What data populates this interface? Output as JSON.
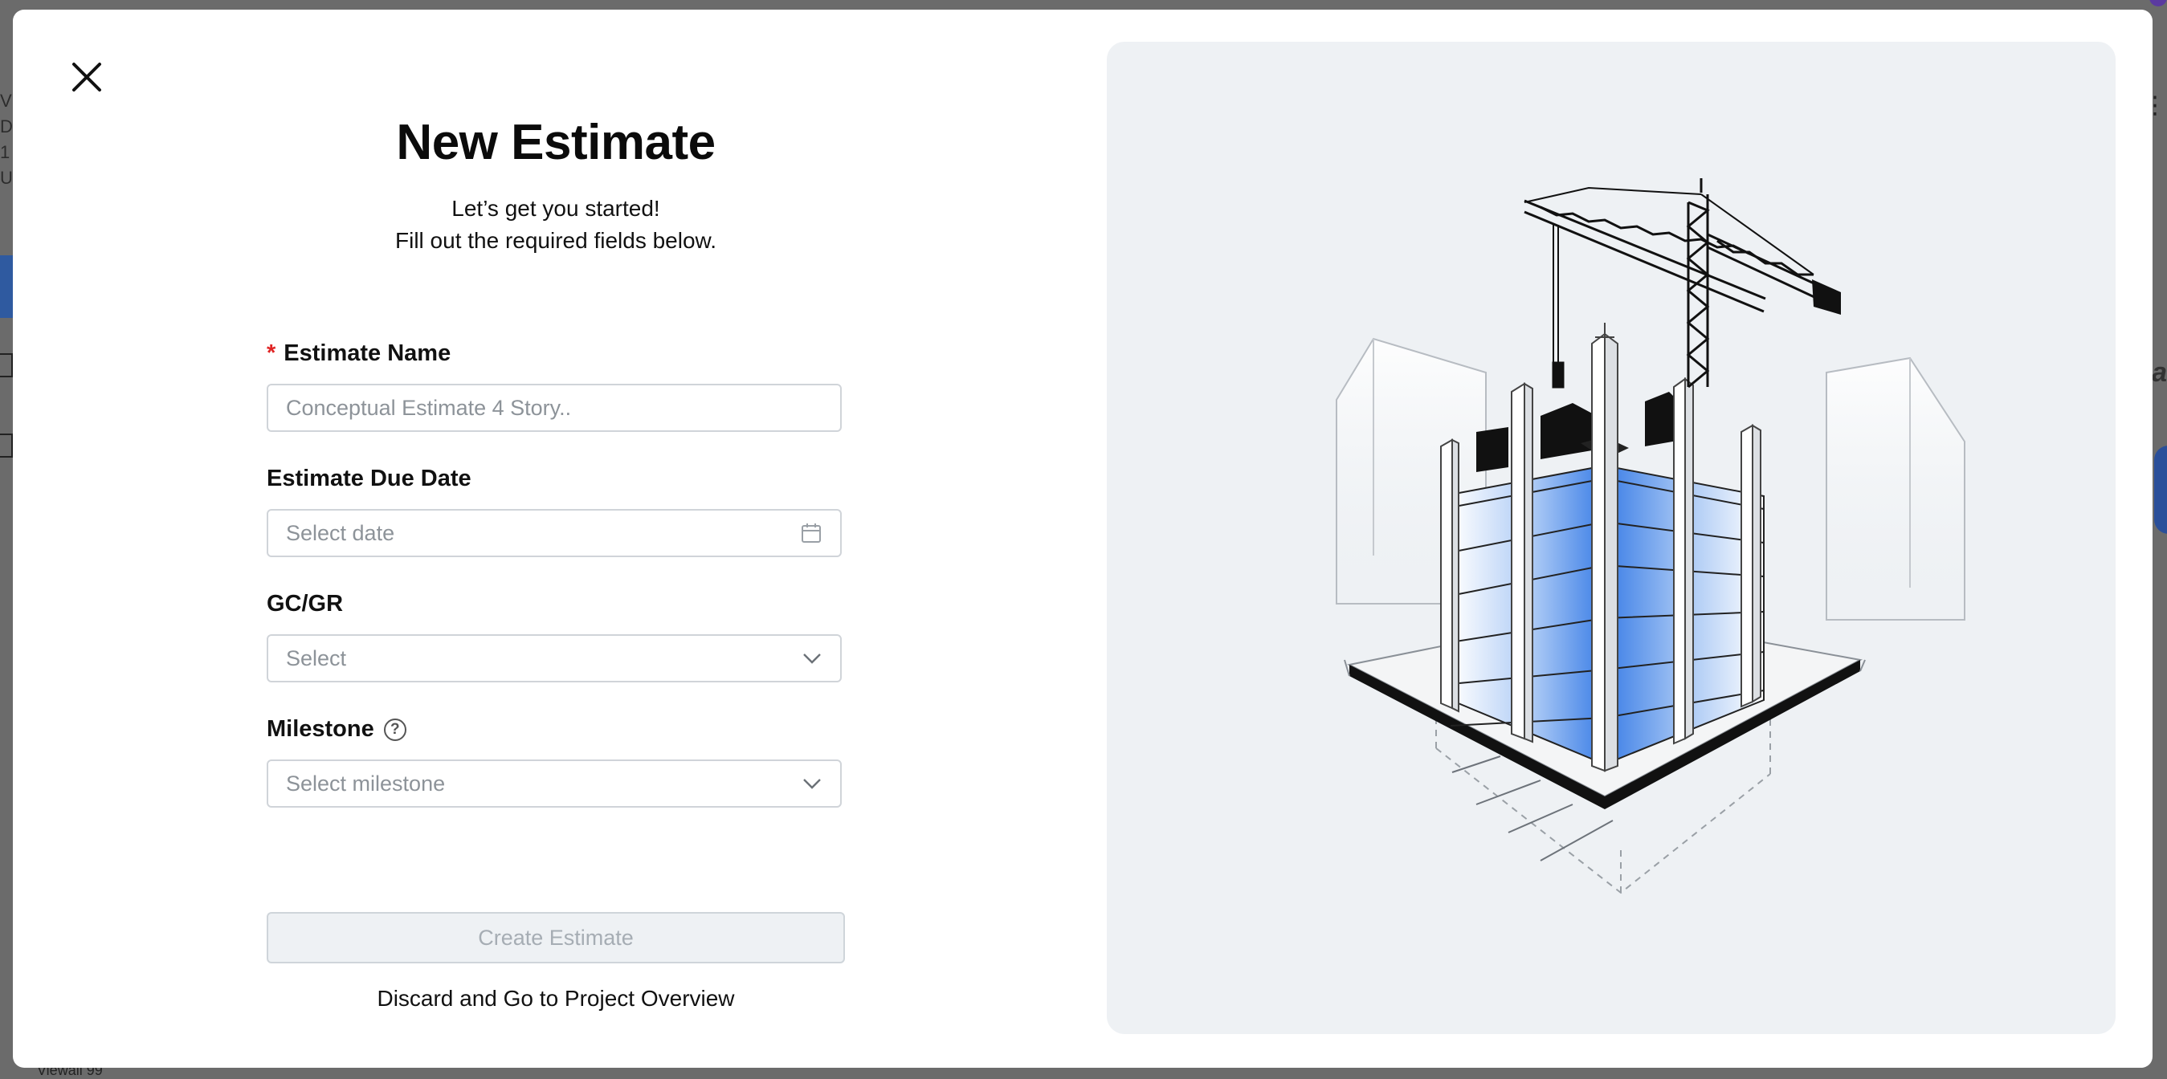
{
  "background": {
    "partial_text_left": [
      "V",
      "D",
      "1",
      "U"
    ],
    "partial_text_right": "a",
    "bottom_text": "Viewall 99"
  },
  "modal": {
    "title": "New Estimate",
    "subtitle_line1": "Let’s get you started!",
    "subtitle_line2": "Fill out the required fields below.",
    "fields": {
      "estimate_name": {
        "label": "Estimate Name",
        "required": true,
        "required_mark": "*",
        "value": "",
        "placeholder": "Conceptual Estimate 4 Story.."
      },
      "due_date": {
        "label": "Estimate Due Date",
        "value": "",
        "placeholder": "Select date",
        "icon": "calendar-icon"
      },
      "gc_gr": {
        "label": "GC/GR",
        "value": "",
        "placeholder": "Select",
        "icon": "chevron-down-icon"
      },
      "milestone": {
        "label": "Milestone",
        "help_icon": "question-circle-icon",
        "value": "",
        "placeholder": "Select milestone",
        "icon": "chevron-down-icon"
      }
    },
    "create_button": {
      "label": "Create Estimate",
      "enabled": false
    },
    "discard_link": "Discard and Go to Project Overview",
    "close_icon": "close-icon"
  },
  "colors": {
    "required": "#e02424",
    "illustration_bg": "#eef1f4",
    "glass_blue": "#3b7ee6",
    "button_disabled_bg": "#eef1f4"
  }
}
